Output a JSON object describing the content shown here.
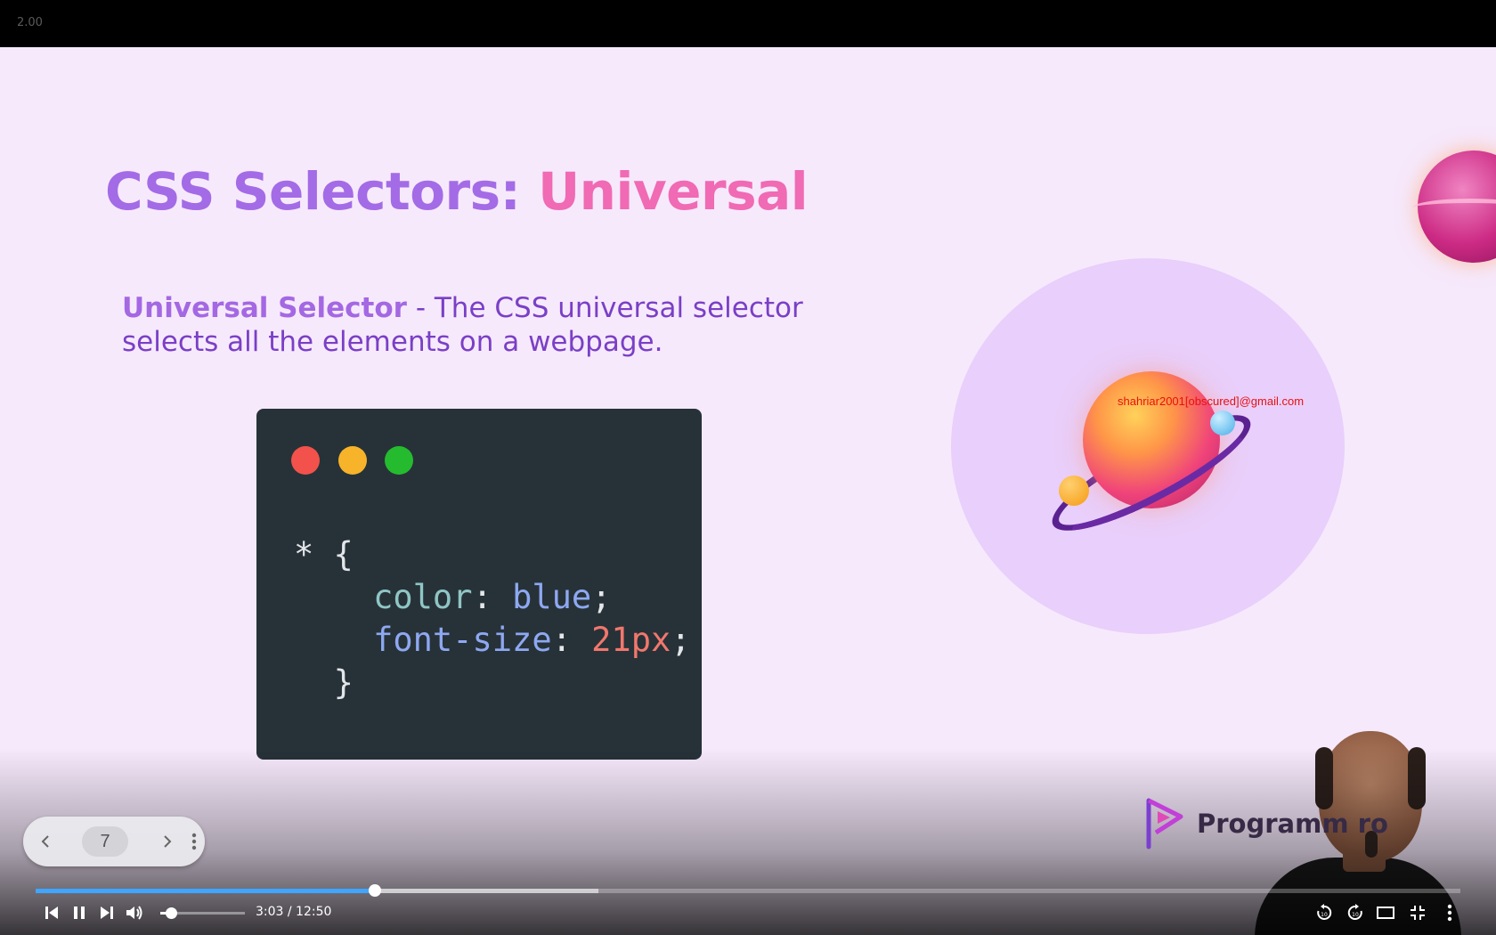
{
  "player": {
    "playback_speed": "2.00",
    "current_time": "3:03",
    "duration": "12:50",
    "time_display": "3:03 / 12:50",
    "progress_fraction": 0.238,
    "buffered_fraction": 0.395,
    "volume_fraction": 0.13,
    "accent_color": "#3ea6ff"
  },
  "slide": {
    "title_main": "CSS Selectors: ",
    "title_accent": "Universal",
    "title_main_color": "#a46be6",
    "title_accent_color": "#f06ab4",
    "description_term": "Universal Selector",
    "description_text": " - The CSS universal selector selects all the elements on a webpage.",
    "code": {
      "line1": "* {",
      "prop1": "color",
      "val1": "blue",
      "prop2": "font-size",
      "val2": "21px",
      "line_close": "}"
    },
    "watermark_email": "shahriar2001[obscured]@gmail.com",
    "logo_text": "Programm      ro"
  },
  "slide_nav": {
    "page_number": "7",
    "prev_icon": "chevron-left-icon",
    "next_icon": "chevron-right-icon",
    "more_icon": "more-vert-icon"
  },
  "controls": {
    "icons": [
      "skip-previous-icon",
      "pause-icon",
      "skip-next-icon",
      "volume-icon",
      "seek-back-10-icon",
      "seek-forward-10-icon",
      "theater-mode-icon",
      "exit-fullscreen-icon",
      "more-vert-icon"
    ],
    "seek_back_label": "10",
    "seek_forward_label": "10"
  }
}
